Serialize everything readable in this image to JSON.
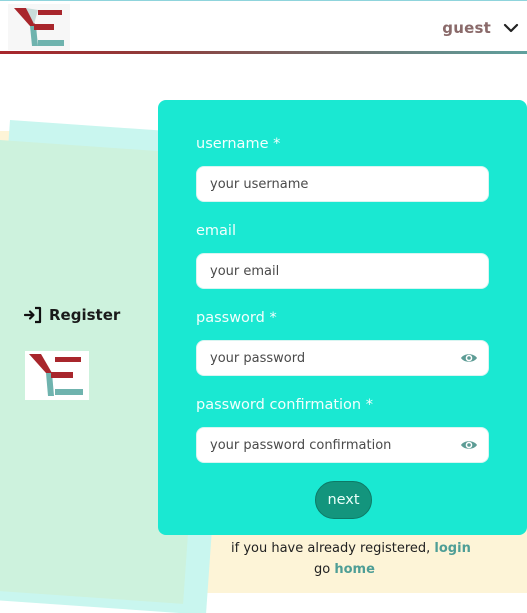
{
  "header": {
    "logo_name": "app-logo",
    "user_menu_label": "guest"
  },
  "sidebar": {
    "register_label": "Register"
  },
  "form": {
    "fields": [
      {
        "label": "username *",
        "placeholder": "your username",
        "value": "",
        "type": "text"
      },
      {
        "label": "email",
        "placeholder": "your email",
        "value": "",
        "type": "email"
      },
      {
        "label": "password *",
        "placeholder": "your password",
        "value": "",
        "type": "password"
      },
      {
        "label": "password confirmation *",
        "placeholder": "your password confirmation",
        "value": "",
        "type": "password"
      }
    ],
    "next_label": "next"
  },
  "footer": {
    "registered_text": "if you have already registered,",
    "login_link": "login",
    "go_text": "go",
    "home_link": "home"
  },
  "colors": {
    "panel": "#1ae8d2",
    "button": "#13957d",
    "link": "#4e9e96",
    "brand_red": "#a8262c",
    "brand_teal": "#5fa19e"
  }
}
